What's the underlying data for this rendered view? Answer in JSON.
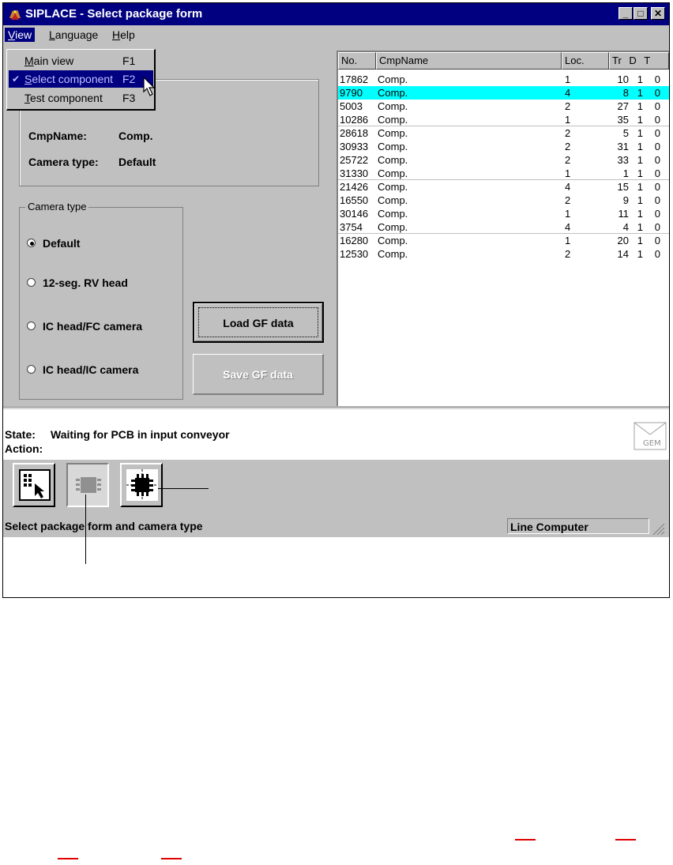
{
  "window": {
    "title": "SIPLACE - Select package form",
    "controls": {
      "minimize": "_",
      "maximize": "□",
      "close": "✕"
    }
  },
  "menubar": {
    "items": [
      {
        "label_u": "V",
        "label_rest": "iew"
      },
      {
        "label_u": "L",
        "label_rest": "anguage"
      },
      {
        "label_u": "H",
        "label_rest": "elp"
      }
    ]
  },
  "view_menu": {
    "items": [
      {
        "label_u": "M",
        "label_rest": "ain view",
        "shortcut": "F1"
      },
      {
        "label_u": "S",
        "label_rest": "elect component",
        "shortcut": "F2",
        "check": "✔"
      },
      {
        "label_u": "T",
        "label_rest": "est component",
        "shortcut": "F3"
      }
    ]
  },
  "info": {
    "cmpname_label": "CmpName:",
    "cmpname_value": "Comp.",
    "camera_label": "Camera type:",
    "camera_value": "Default"
  },
  "camera_group": {
    "title": "Camera type",
    "options": [
      "Default",
      "12-seg. RV head",
      "IC head/FC camera",
      "IC head/IC camera"
    ],
    "selected_index": 0
  },
  "buttons": {
    "load": "Load GF data",
    "save": "Save GF data"
  },
  "component_list": {
    "columns": [
      "No.",
      "CmpName",
      "Loc.",
      "Tr",
      "D",
      "T"
    ],
    "rows": [
      [
        "17862",
        "Comp.",
        "1",
        "10",
        "1",
        "0"
      ],
      [
        "9790",
        "Comp.",
        "4",
        "8",
        "1",
        "0"
      ],
      [
        "5003",
        "Comp.",
        "2",
        "27",
        "1",
        "0"
      ],
      [
        "10286",
        "Comp.",
        "1",
        "35",
        "1",
        "0"
      ],
      [
        "28618",
        "Comp.",
        "2",
        "5",
        "1",
        "0"
      ],
      [
        "30933",
        "Comp.",
        "2",
        "31",
        "1",
        "0"
      ],
      [
        "25722",
        "Comp.",
        "2",
        "33",
        "1",
        "0"
      ],
      [
        "31330",
        "Comp.",
        "1",
        "1",
        "1",
        "0"
      ],
      [
        "21426",
        "Comp.",
        "4",
        "15",
        "1",
        "0"
      ],
      [
        "16550",
        "Comp.",
        "2",
        "9",
        "1",
        "0"
      ],
      [
        "30146",
        "Comp.",
        "1",
        "11",
        "1",
        "0"
      ],
      [
        "3754",
        "Comp.",
        "4",
        "4",
        "1",
        "0"
      ],
      [
        "16280",
        "Comp.",
        "1",
        "20",
        "1",
        "0"
      ],
      [
        "12530",
        "Comp.",
        "2",
        "14",
        "1",
        "0"
      ]
    ],
    "selected_index": 1
  },
  "state": {
    "state_label": "State:",
    "state_value": "Waiting for PCB in input conveyor",
    "action_label": "Action:",
    "gem_text": "GEM"
  },
  "statusbar": {
    "message": "Select package form and camera type",
    "source": "Line Computer"
  },
  "colors": {
    "titlebar": "#000080",
    "selection": "#00ffff",
    "face": "#c0c0c0",
    "marker": "#e00000"
  }
}
